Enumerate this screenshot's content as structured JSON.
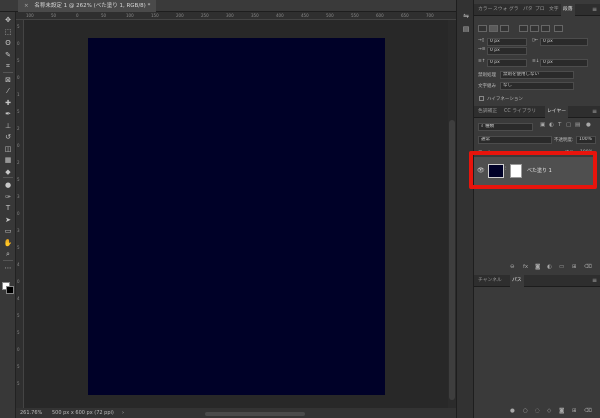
{
  "document_tab": {
    "close": "×",
    "title": "名称未設定 1 @ 262% (べた塗り 1, RGB/8) *"
  },
  "ruler_h_ticks": [
    "100",
    "50",
    "0",
    "50",
    "100",
    "150",
    "200",
    "250",
    "300",
    "350",
    "400",
    "450",
    "500",
    "550",
    "600",
    "650",
    "700"
  ],
  "ruler_v_ticks": [
    "5",
    "0",
    "5",
    "0",
    "1",
    "5",
    "2",
    "0",
    "2",
    "5",
    "3",
    "0",
    "3",
    "5",
    "4",
    "0",
    "4",
    "5",
    "5",
    "0",
    "5",
    "5"
  ],
  "toolbar_icons": [
    "move-icon",
    "marquee-icon",
    "lasso-icon",
    "quick-select-icon",
    "crop-icon",
    "frame-icon",
    "eyedropper-icon",
    "spot-heal-icon",
    "brush-icon",
    "stamp-icon",
    "history-brush-icon",
    "eraser-icon",
    "gradient-icon",
    "blur-icon",
    "dodge-icon",
    "pen-icon",
    "type-icon",
    "path-select-icon",
    "rectangle-icon",
    "hand-icon",
    "zoom-icon",
    "more-icon"
  ],
  "status": {
    "zoom": "261.76%",
    "doc_size": "500 px x 600 px (72 ppi)",
    "arrow": "›"
  },
  "document_color": "#000128",
  "highlight_color": "#e8140c",
  "char_panel": {
    "tabs": [
      "カラー",
      "スウォ",
      "グラ",
      "パタ",
      "プロ",
      "文字",
      "段落"
    ],
    "active_tab": "段落",
    "indent_left": "0 px",
    "indent_right": "0 px",
    "indent_first": "0 px",
    "space_before": "0 px",
    "space_after": "0 px",
    "kinsoku_label": "禁則処理",
    "kinsoku_value": "禁則を使用しない",
    "mojikumi_label": "文字組み",
    "mojikumi_value": "なし",
    "hyphenation": "ハイフネーション"
  },
  "layers_panel": {
    "tabs": [
      "色調補正",
      "CC ライブラリ",
      "レイヤー"
    ],
    "active_tab": "レイヤー",
    "filter_label": "種類",
    "blend_mode": "通常",
    "opacity_label": "不透明度:",
    "opacity_value": "100%",
    "lock_label": "ロック:",
    "fill_label": "塗り:",
    "fill_value": "100%",
    "layer": {
      "name": "べた塗り 1",
      "visible": true
    }
  },
  "channels_panel": {
    "tabs": [
      "チャンネル",
      "パス"
    ],
    "active_tab": "パス"
  }
}
